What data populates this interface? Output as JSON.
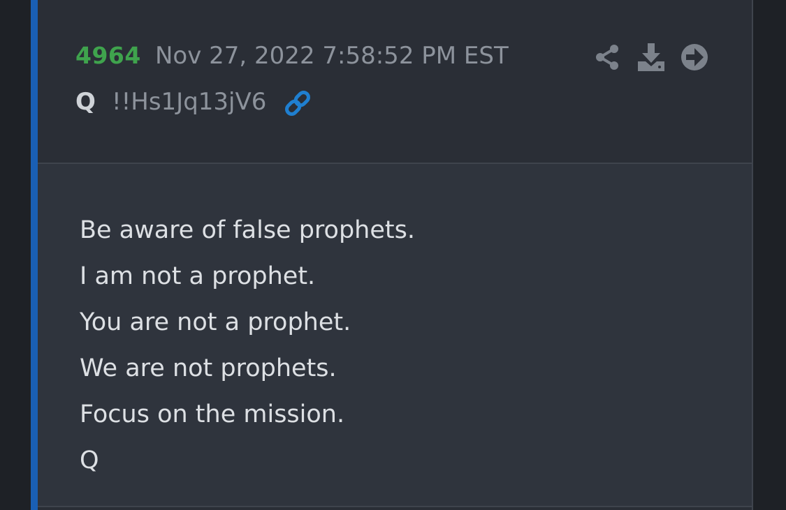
{
  "post": {
    "number": "4964",
    "date": "Nov 27, 2022 7:58:52 PM EST",
    "author": "Q",
    "tripcode": "!!Hs1Jq13jV6",
    "accent_color": "#1a5fb4",
    "number_color": "#3fa34d",
    "link_color": "#1f7fd0",
    "actions": [
      {
        "name": "share",
        "icon": "share-icon"
      },
      {
        "name": "download",
        "icon": "download-icon"
      },
      {
        "name": "go",
        "icon": "arrow-circle-right-icon"
      }
    ],
    "message": [
      "Be aware of false prophets.",
      "I am not a prophet.",
      "You are not a prophet.",
      "We are not prophets.",
      "Focus on the mission.",
      "Q"
    ]
  }
}
